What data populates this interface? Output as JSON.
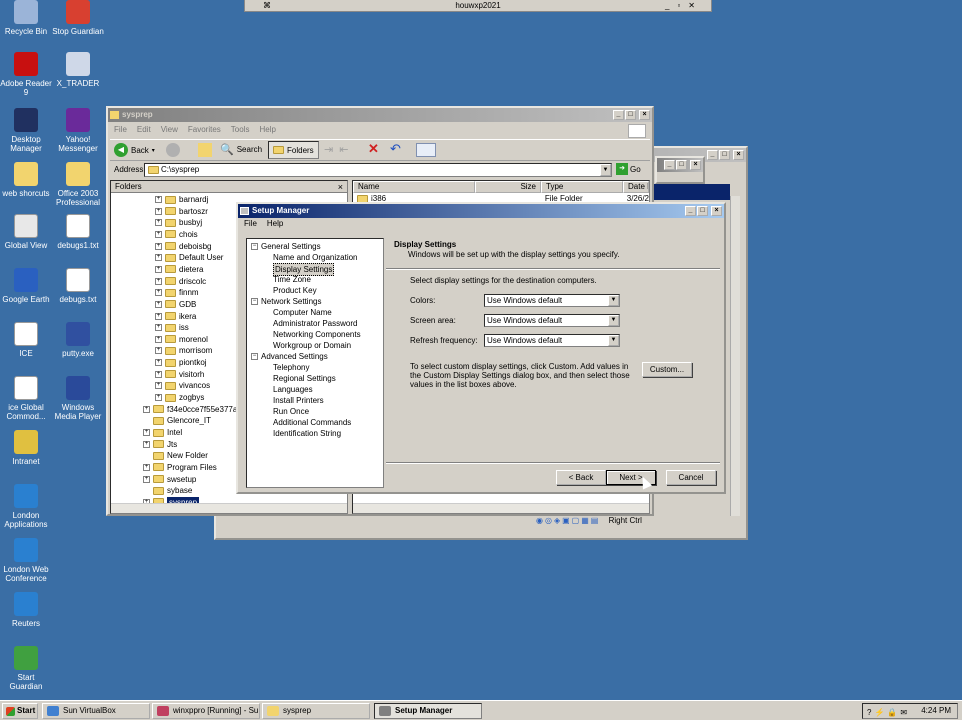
{
  "desktop_icons": [
    {
      "label": "Recycle Bin",
      "icon": "recycle-bin-icon",
      "color": "#9bb4d8"
    },
    {
      "label": "Stop Guardian",
      "icon": "stop-guardian-icon",
      "color": "#d84030"
    },
    {
      "label": "Adobe Reader 9",
      "icon": "adobe-reader-icon",
      "color": "#c81010"
    },
    {
      "label": "X_TRADER",
      "icon": "x-trader-icon",
      "color": "#cfd8e8"
    },
    {
      "label": "Desktop Manager",
      "icon": "desktop-manager-icon",
      "color": "#203060"
    },
    {
      "label": "Yahoo! Messenger",
      "icon": "yahoo-messenger-icon",
      "color": "#6a2a9a"
    },
    {
      "label": "web shorcuts",
      "icon": "folder-icon",
      "color": "#f2d46e"
    },
    {
      "label": "Office 2003 Professional",
      "icon": "folder-icon",
      "color": "#f2d46e"
    },
    {
      "label": "Global View",
      "icon": "global-view-icon",
      "color": "#e8e8e8"
    },
    {
      "label": "debugs1.txt",
      "icon": "text-file-icon",
      "color": "#ffffff"
    },
    {
      "label": "Google Earth",
      "icon": "google-earth-icon",
      "color": "#2a60c0"
    },
    {
      "label": "debugs.txt",
      "icon": "text-file-icon",
      "color": "#ffffff"
    },
    {
      "label": "ICE",
      "icon": "document-icon",
      "color": "#ffffff"
    },
    {
      "label": "putty.exe",
      "icon": "putty-icon",
      "color": "#3050a0"
    },
    {
      "label": "ice Global Commod...",
      "icon": "document-icon",
      "color": "#ffffff"
    },
    {
      "label": "Windows Media Player",
      "icon": "media-player-icon",
      "color": "#2a4a9a"
    },
    {
      "label": "Intranet",
      "icon": "intranet-icon",
      "color": "#e0c040"
    },
    {
      "label": "London Applications",
      "icon": "internet-explorer-icon",
      "color": "#2a80d0"
    },
    {
      "label": "London Web Conference",
      "icon": "internet-explorer-icon",
      "color": "#2a80d0"
    },
    {
      "label": "Reuters",
      "icon": "internet-explorer-icon",
      "color": "#2a80d0"
    },
    {
      "label": "Start Guardian",
      "icon": "start-guardian-icon",
      "color": "#40a040"
    }
  ],
  "vbox_bar": {
    "title": "houwxp2021"
  },
  "explorer": {
    "title": "sysprep",
    "menu": [
      "File",
      "Edit",
      "View",
      "Favorites",
      "Tools",
      "Help"
    ],
    "toolbar": {
      "back": "Back",
      "search": "Search",
      "folders": "Folders"
    },
    "address_label": "Address",
    "address_value": "C:\\sysprep",
    "go": "Go",
    "folders_pane_title": "Folders",
    "tree": [
      "barnardj",
      "bartoszr",
      "busbyj",
      "chois",
      "deboisbg",
      "Default User",
      "dietera",
      "driscolc",
      "finnm",
      "GDB",
      "ikera",
      "iss",
      "morenol",
      "morrisom",
      "piontkoj",
      "visitorh",
      "vivancos",
      "zogbys",
      "f34e0cce7f55e377afc",
      "Glencore_IT",
      "Intel",
      "Jts",
      "New Folder",
      "Program Files",
      "swsetup",
      "sybase",
      "sysprep"
    ],
    "columns": [
      "Name",
      "Size",
      "Type",
      "Date M"
    ],
    "rows": [
      {
        "name": "i386",
        "size": "",
        "type": "File Folder",
        "date": "3/26/2"
      }
    ]
  },
  "setup_manager": {
    "title": "Setup Manager",
    "menu": [
      "File",
      "Help"
    ],
    "tree": {
      "general": "General Settings",
      "general_items": [
        "Name and Organization",
        "Display Settings",
        "Time Zone",
        "Product Key"
      ],
      "network": "Network Settings",
      "network_items": [
        "Computer Name",
        "Administrator Password",
        "Networking Components",
        "Workgroup or Domain"
      ],
      "advanced": "Advanced Settings",
      "advanced_items": [
        "Telephony",
        "Regional Settings",
        "Languages",
        "Install Printers",
        "Run Once",
        "Additional Commands",
        "Identification String"
      ]
    },
    "heading": "Display Settings",
    "subheading": "Windows will be set up with the display settings you specify.",
    "instruction": "Select display settings for the destination computers.",
    "colors_label": "Colors:",
    "colors_value": "Use Windows default",
    "screen_label": "Screen area:",
    "screen_value": "Use Windows default",
    "refresh_label": "Refresh frequency:",
    "refresh_value": "Use Windows default",
    "custom_text": "To select custom display settings, click Custom. Add values in the Custom Display Settings dialog box, and then select those values in the list boxes above.",
    "custom_button": "Custom...",
    "back_button": "< Back",
    "next_button": "Next >",
    "cancel_button": "Cancel"
  },
  "vbox_status": {
    "right_ctrl": "Right Ctrl"
  },
  "taskbar": {
    "start": "Start",
    "tasks": [
      "Sun VirtualBox",
      "winxppro [Running] - Su...",
      "sysprep",
      "Setup Manager"
    ],
    "time": "4:24 PM"
  }
}
